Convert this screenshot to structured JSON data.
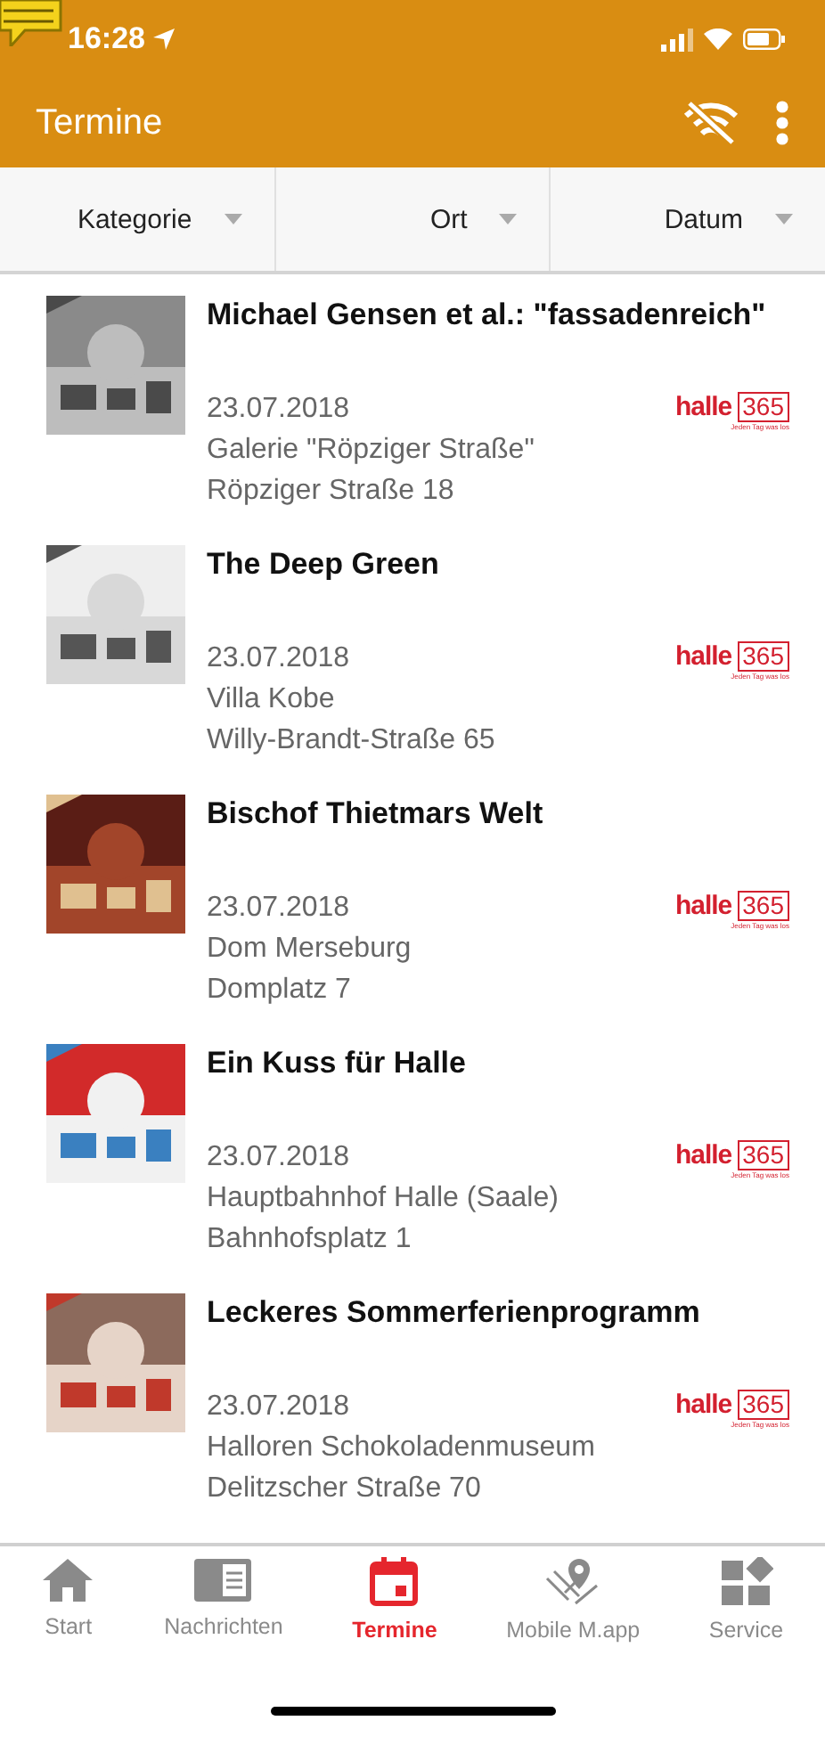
{
  "status_bar": {
    "time": "16:28"
  },
  "app_bar": {
    "title": "Termine"
  },
  "filters": [
    {
      "label": "Kategorie"
    },
    {
      "label": "Ort"
    },
    {
      "label": "Datum"
    }
  ],
  "events": [
    {
      "title": "Michael Gensen et al.: \"fassadenreich\"",
      "date": "23.07.2018",
      "venue": "Galerie \"Röpziger Straße\"",
      "address": "Röpziger Straße 18",
      "logo": {
        "word": "halle",
        "number": "365",
        "tagline": "Jeden Tag was los"
      }
    },
    {
      "title": "The Deep Green",
      "date": "23.07.2018",
      "venue": "Villa Kobe",
      "address": "Willy-Brandt-Straße 65",
      "logo": {
        "word": "halle",
        "number": "365",
        "tagline": "Jeden Tag was los"
      }
    },
    {
      "title": "Bischof Thietmars Welt",
      "date": "23.07.2018",
      "venue": "Dom Merseburg",
      "address": "Domplatz 7",
      "logo": {
        "word": "halle",
        "number": "365",
        "tagline": "Jeden Tag was los"
      }
    },
    {
      "title": "Ein Kuss für Halle",
      "date": "23.07.2018",
      "venue": "Hauptbahnhof Halle (Saale)",
      "address": "Bahnhofsplatz 1",
      "logo": {
        "word": "halle",
        "number": "365",
        "tagline": "Jeden Tag was los"
      }
    },
    {
      "title": "Leckeres Sommerferienprogramm",
      "date": "23.07.2018",
      "venue": "Halloren Schokoladenmuseum",
      "address": "Delitzscher Straße 70",
      "logo": {
        "word": "halle",
        "number": "365",
        "tagline": "Jeden Tag was los"
      }
    }
  ],
  "tabs": [
    {
      "label": "Start",
      "selected": false
    },
    {
      "label": "Nachrichten",
      "selected": false
    },
    {
      "label": "Termine",
      "selected": true
    },
    {
      "label": "Mobile M.app",
      "selected": false
    },
    {
      "label": "Service",
      "selected": false
    }
  ]
}
